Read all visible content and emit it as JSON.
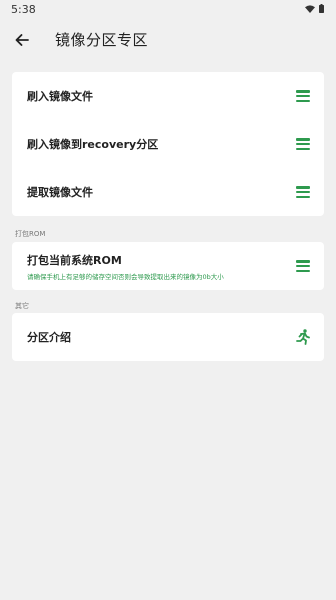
{
  "status_bar": {
    "time": "5:38",
    "wifi_icon": "wifi-icon",
    "battery_icon": "battery-icon"
  },
  "header": {
    "back_icon": "arrow-left-icon",
    "title": "镜像分区专区"
  },
  "image_section": {
    "items": [
      {
        "label": "刷入镜像文件",
        "icon": "menu-icon"
      },
      {
        "label": "刷入镜像到recovery分区",
        "icon": "menu-icon"
      },
      {
        "label": "提取镜像文件",
        "icon": "menu-icon"
      }
    ]
  },
  "pack_section": {
    "header": "打包ROM",
    "item": {
      "title": "打包当前系统ROM",
      "subtitle": "请确保手机上有足够的储存空间否则会导致提取出来的镜像为0b大小",
      "icon": "menu-icon"
    }
  },
  "other_section": {
    "header": "其它",
    "item": {
      "label": "分区介绍",
      "icon": "running-person-icon"
    }
  },
  "colors": {
    "accent": "#2e9a4e",
    "background": "#f0f0f0",
    "card": "#ffffff"
  }
}
